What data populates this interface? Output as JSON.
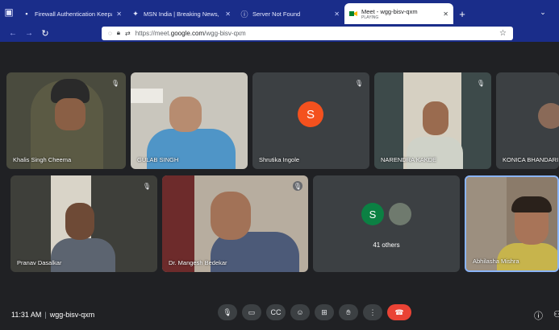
{
  "tabs": [
    {
      "title": "Firewall Authentication Keepalive W",
      "icon": "shield-icon"
    },
    {
      "title": "MSN India | Breaking News, Ent",
      "icon": "msn-icon"
    },
    {
      "title": "Server Not Found",
      "icon": "info-icon"
    },
    {
      "title": "Meet - wgg-bisv-qxm",
      "subtitle": "PLAYING",
      "icon": "meet-icon"
    }
  ],
  "url": {
    "prefix": "https://meet.",
    "domain": "google.com",
    "path": "/wgg-bisv-qxm"
  },
  "participants_row1": [
    {
      "name": "Khalis Singh Cheema",
      "muted": true
    },
    {
      "name": "GULAB SINGH",
      "muted": false
    },
    {
      "name": "Shrutika Ingole",
      "muted": true,
      "initial": "S"
    },
    {
      "name": "NARENDRA KAKDE",
      "muted": true
    },
    {
      "name": "KONICA BHANDARI",
      "muted": false
    }
  ],
  "participants_row2": [
    {
      "name": "Pranav Dasalkar",
      "muted": true
    },
    {
      "name": "Dr. Mangesh Bedekar",
      "muted": true
    },
    {
      "name": "41 others",
      "initial": "S"
    },
    {
      "name": "Abhilasha Mishra",
      "muted": false
    }
  ],
  "meeting": {
    "time": "11:31 AM",
    "code": "wgg-bisv-qxm"
  },
  "colors": {
    "accent": "#1a2d8a",
    "end_call": "#ea4335",
    "avatar_orange": "#f4511e",
    "avatar_teal": "#0b8043",
    "highlight": "#8ab4f8"
  }
}
